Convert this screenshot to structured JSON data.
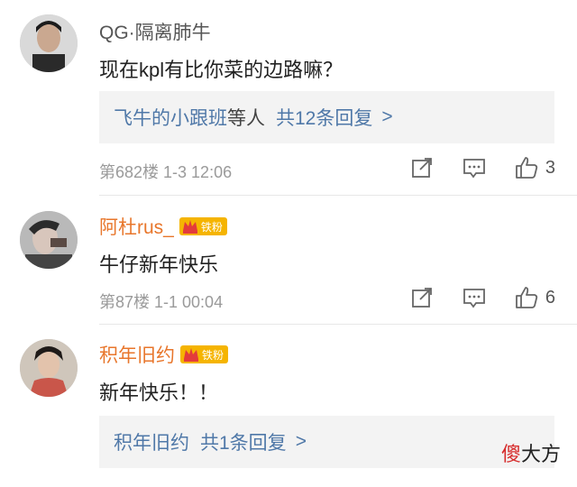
{
  "comments": [
    {
      "username": "QG·隔离肺牛",
      "text": "现在kpl有比你菜的边路嘛？",
      "reply": {
        "names": "飞牛的小跟班",
        "connector": "等人",
        "count_text": "共12条回复",
        "more": ">"
      },
      "meta": "第682楼  1-3  12:06",
      "likes": "3"
    },
    {
      "username": "阿杜rus_",
      "badge": "铁粉",
      "text": "牛仔新年快乐",
      "meta": "第87楼  1-1  00:04",
      "likes": "6"
    },
    {
      "username": "积年旧约",
      "badge": "铁粉",
      "text": "新年快乐！！",
      "reply": {
        "names": "积年旧约",
        "connector": "",
        "count_text": "共1条回复",
        "more": ">"
      }
    }
  ],
  "watermark": {
    "part1": "傻",
    "part2": "大方"
  },
  "colors": {
    "link": "#4f78a8",
    "username_highlight": "#e8762b",
    "badge": "#f5b400"
  }
}
